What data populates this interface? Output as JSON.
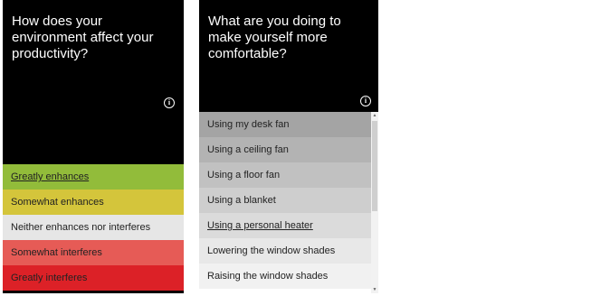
{
  "card1": {
    "question": "How does your environment affect your productivity?",
    "info_icon": "info-icon",
    "options": [
      {
        "label": "Greatly enhances",
        "color": "#92bc3a"
      },
      {
        "label": "Somewhat enhances",
        "color": "#d4c53b"
      },
      {
        "label": "Neither enhances nor interferes",
        "color": "#e6e6e6"
      },
      {
        "label": "Somewhat interferes",
        "color": "#e65b56"
      },
      {
        "label": "Greatly interferes",
        "color": "#dc2127"
      }
    ]
  },
  "card2": {
    "question": "What are you doing to make yourself more comfortable?",
    "info_icon": "info-icon",
    "options": [
      {
        "label": "Using my desk fan",
        "color": "#a4a4a4"
      },
      {
        "label": "Using a ceiling fan",
        "color": "#b3b3b3"
      },
      {
        "label": "Using a floor fan",
        "color": "#c1c1c1"
      },
      {
        "label": "Using a blanket",
        "color": "#cecece"
      },
      {
        "label": "Using a personal heater",
        "color": "#dbdbdb"
      },
      {
        "label": "Lowering the window shades",
        "color": "#e8e8e8"
      },
      {
        "label": "Raising the window shades",
        "color": "#f1f1f1"
      }
    ],
    "scroll": {
      "up_arrow": "▲",
      "down_arrow": "▼"
    }
  }
}
